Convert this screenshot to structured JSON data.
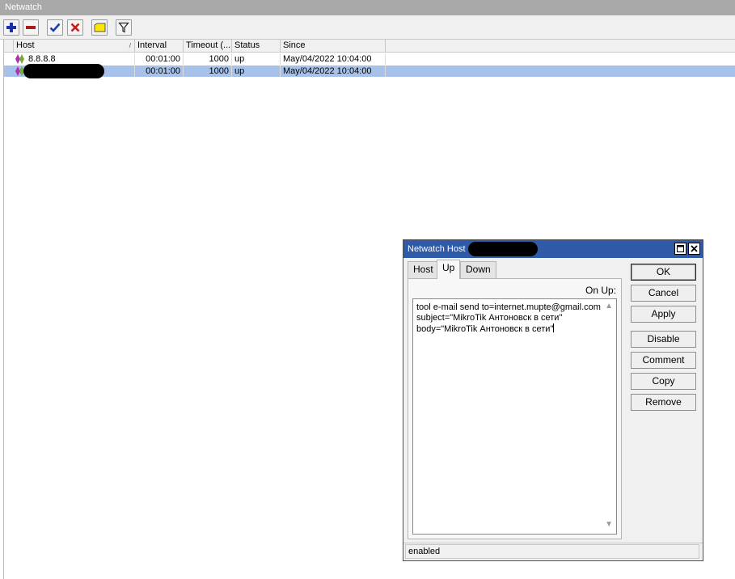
{
  "window": {
    "title": "Netwatch"
  },
  "toolbar": {
    "buttons": [
      {
        "name": "add-button",
        "icon": "plus-icon"
      },
      {
        "name": "remove-button",
        "icon": "minus-icon"
      },
      {
        "name": "enable-button",
        "icon": "check-icon"
      },
      {
        "name": "disable-button",
        "icon": "cross-icon"
      },
      {
        "name": "comment-button",
        "icon": "note-icon"
      },
      {
        "name": "filter-button",
        "icon": "filter-icon"
      }
    ]
  },
  "table": {
    "columns": [
      "Host",
      "Interval",
      "Timeout (...",
      "Status",
      "Since"
    ],
    "sort_indicator": "/",
    "rows": [
      {
        "host": "8.8.8.8",
        "interval": "00:01:00",
        "timeout": "1000",
        "status": "up",
        "since": "May/04/2022 10:04:00",
        "selected": false
      },
      {
        "host": "",
        "interval": "00:01:00",
        "timeout": "1000",
        "status": "up",
        "since": "May/04/2022 10:04:00",
        "selected": true
      }
    ]
  },
  "dialog": {
    "title": "Netwatch Host <",
    "tabs": [
      "Host",
      "Up",
      "Down"
    ],
    "active_tab": "Up",
    "field_label": "On Up:",
    "script": "tool e-mail send to=internet.mupte@gmail.com\nsubject=\"MikroTik Антоновск в сети\"\nbody=\"MikroTik Антоновск в сети\"",
    "buttons": {
      "ok": "OK",
      "cancel": "Cancel",
      "apply": "Apply",
      "disable": "Disable",
      "comment": "Comment",
      "copy": "Copy",
      "remove": "Remove"
    },
    "status": "enabled"
  },
  "colors": {
    "selection": "#a7c2ea",
    "dialog_title_bar": "#2f5aa8",
    "window_title_bar": "#a9a9a9"
  }
}
